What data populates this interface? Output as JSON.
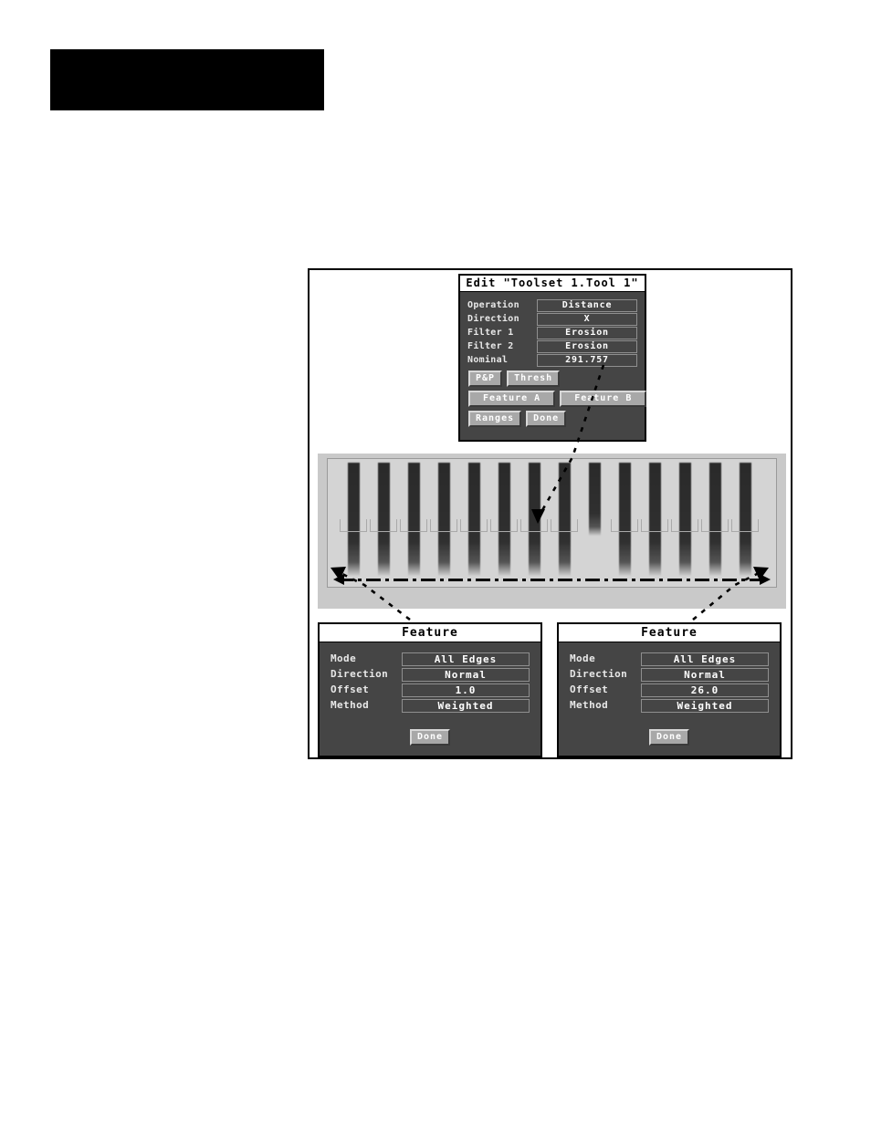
{
  "page": {
    "header_block": {
      "label": "redacted-header-bar",
      "color": "#000000"
    }
  },
  "figure": {
    "edit_dialog": {
      "title": "Edit \"Toolset 1.Tool 1\"",
      "fields": [
        {
          "label": "Operation",
          "value": "Distance"
        },
        {
          "label": "Direction",
          "value": "X"
        },
        {
          "label": "Filter 1",
          "value": "Erosion"
        },
        {
          "label": "Filter 2",
          "value": "Erosion"
        },
        {
          "label": "Nominal",
          "value": "291.757"
        }
      ],
      "buttons": [
        {
          "label": "P&P"
        },
        {
          "label": "Thresh"
        },
        {
          "label": "Feature A"
        },
        {
          "label": "Feature B"
        },
        {
          "label": "Ranges"
        },
        {
          "label": "Done"
        }
      ]
    },
    "vision_image": {
      "caption": "grayscale-connector-pin-image",
      "measurement": "distance-span-arrow"
    },
    "feature_a_dialog": {
      "title": "Feature",
      "fields": [
        {
          "label": "Mode",
          "value": "All Edges"
        },
        {
          "label": "Direction",
          "value": "Normal"
        },
        {
          "label": "Offset",
          "value": "1.0"
        },
        {
          "label": "Method",
          "value": "Weighted"
        }
      ],
      "done_label": "Done"
    },
    "feature_b_dialog": {
      "title": "Feature",
      "fields": [
        {
          "label": "Mode",
          "value": "All Edges"
        },
        {
          "label": "Direction",
          "value": "Normal"
        },
        {
          "label": "Offset",
          "value": "26.0"
        },
        {
          "label": "Method",
          "value": "Weighted"
        }
      ],
      "done_label": "Done"
    }
  },
  "colors": {
    "dialog_bg": "#454545",
    "title_bg": "#ffffff",
    "button_face": "#a8a8a8",
    "field_border": "#8f8f8f",
    "image_bg": "#d4d4d4"
  }
}
